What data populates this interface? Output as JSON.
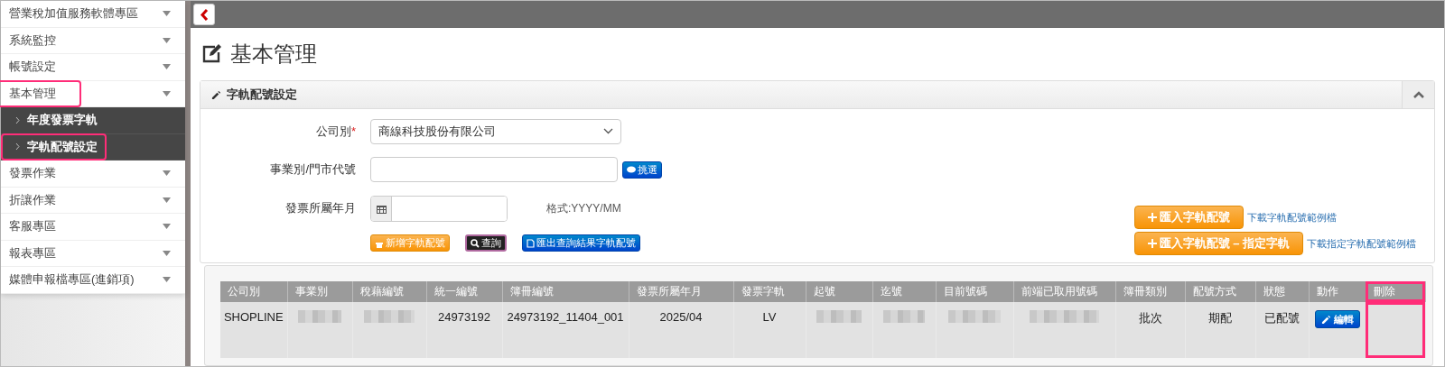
{
  "sidebar": {
    "items": [
      {
        "label": "營業稅加值服務軟體專區",
        "highlighted": false
      },
      {
        "label": "系統監控",
        "highlighted": false
      },
      {
        "label": "帳號設定",
        "highlighted": false
      },
      {
        "label": "基本管理",
        "highlighted": true,
        "children": [
          {
            "label": "年度發票字軌",
            "highlighted": false
          },
          {
            "label": "字軌配號設定",
            "highlighted": true
          }
        ]
      },
      {
        "label": "發票作業",
        "highlighted": false
      },
      {
        "label": "折讓作業",
        "highlighted": false
      },
      {
        "label": "客服專區",
        "highlighted": false
      },
      {
        "label": "報表專區",
        "highlighted": false
      },
      {
        "label": "媒體申報檔專區(進銷項)",
        "highlighted": false
      }
    ]
  },
  "page_title": "基本管理",
  "panel": {
    "title": "字軌配號設定",
    "form": [
      {
        "kind": "select",
        "label": "公司別",
        "required_mark": "*",
        "value": "商線科技股份有限公司"
      },
      {
        "kind": "text",
        "label": "事業別/門市代號",
        "button": "挑選"
      },
      {
        "kind": "date",
        "label": "發票所屬年月",
        "hint": "格式:YYYY/MM"
      }
    ],
    "actions": [
      {
        "label": "新增字軌配號",
        "kind": "orange"
      },
      {
        "label": "查詢",
        "kind": "dark"
      },
      {
        "label": "匯出查詢結果字軌配號",
        "kind": "blue"
      }
    ],
    "imports": [
      {
        "button": "匯入字軌配號",
        "link": "下載字軌配號範例檔"
      },
      {
        "button": "匯入字軌配號 – 指定字軌",
        "link": "下載指定字軌配號範例檔"
      }
    ]
  },
  "table": {
    "columns": [
      {
        "label": "公司別",
        "highlighted": false
      },
      {
        "label": "事業別",
        "highlighted": false
      },
      {
        "label": "稅藉編號",
        "highlighted": false
      },
      {
        "label": "統一編號",
        "highlighted": false
      },
      {
        "label": "簿冊編號",
        "highlighted": false
      },
      {
        "label": "發票所屬年月",
        "highlighted": false
      },
      {
        "label": "發票字軌",
        "highlighted": false
      },
      {
        "label": "起號",
        "highlighted": false
      },
      {
        "label": "迄號",
        "highlighted": false
      },
      {
        "label": "目前號碼",
        "highlighted": false
      },
      {
        "label": "前端已取用號碼",
        "highlighted": false
      },
      {
        "label": "簿冊類別",
        "highlighted": false
      },
      {
        "label": "配號方式",
        "highlighted": false
      },
      {
        "label": "狀態",
        "highlighted": false
      },
      {
        "label": "動作",
        "highlighted": false
      },
      {
        "label": "刪除",
        "highlighted": true
      }
    ],
    "rows": [
      {
        "cells": [
          {
            "kind": "text",
            "text": "SHOPLINE"
          },
          {
            "kind": "redacted"
          },
          {
            "kind": "redacted"
          },
          {
            "kind": "text",
            "text": "24973192"
          },
          {
            "kind": "text",
            "text": "24973192_11404_001"
          },
          {
            "kind": "text",
            "text": "2025/04"
          },
          {
            "kind": "text",
            "text": "LV"
          },
          {
            "kind": "redacted"
          },
          {
            "kind": "redacted"
          },
          {
            "kind": "redacted"
          },
          {
            "kind": "redacted"
          },
          {
            "kind": "text",
            "text": "批次"
          },
          {
            "kind": "text",
            "text": "期配"
          },
          {
            "kind": "text",
            "text": "已配號"
          },
          {
            "kind": "button",
            "text": "編輯"
          },
          {
            "kind": "empty"
          }
        ]
      }
    ]
  }
}
